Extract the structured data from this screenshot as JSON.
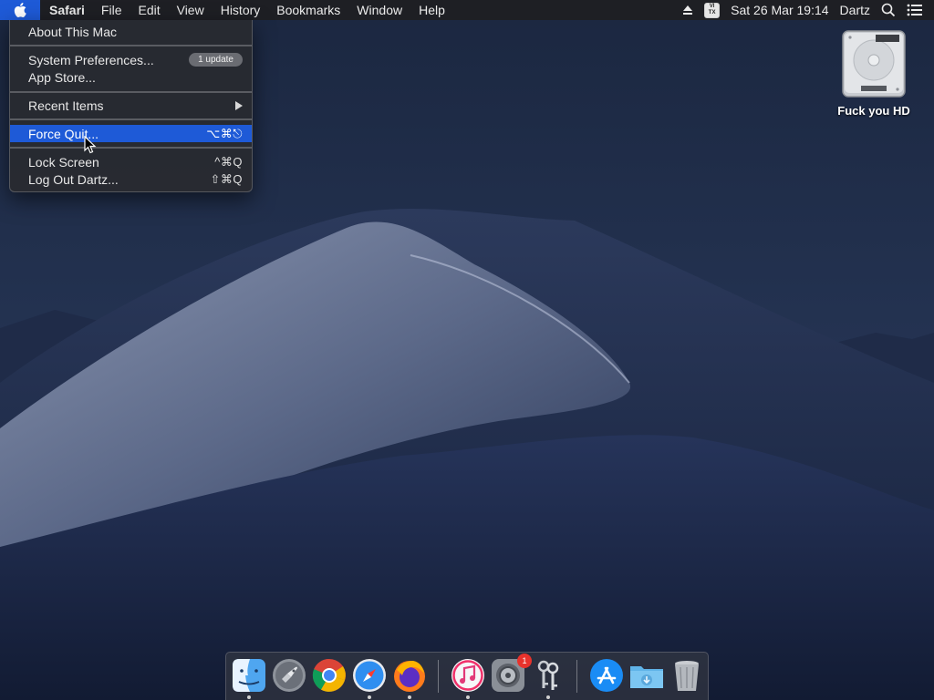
{
  "menubar": {
    "app_name": "Safari",
    "menus": [
      "File",
      "Edit",
      "View",
      "History",
      "Bookmarks",
      "Window",
      "Help"
    ],
    "input_source": [
      "VI",
      "TX"
    ],
    "datetime": "Sat 26 Mar  19:14",
    "user": "Dartz",
    "icons": [
      "apple-icon",
      "eject-icon",
      "input-source-icon",
      "spotlight-search-icon",
      "notification-center-icon"
    ]
  },
  "apple_menu": {
    "about": "About This Mac",
    "system_preferences": "System Preferences...",
    "system_preferences_badge": "1 update",
    "app_store": "App Store...",
    "recent_items": "Recent Items",
    "force_quit": "Force Quit...",
    "force_quit_shortcut": "⌥⌘⎋",
    "lock_screen": "Lock Screen",
    "lock_screen_shortcut": "^⌘Q",
    "log_out": "Log Out Dartz...",
    "log_out_shortcut": "⇧⌘Q",
    "highlighted": "Force Quit..."
  },
  "desktop": {
    "drive_label": "Fuck you HD"
  },
  "dock": {
    "apps": [
      "Finder",
      "Launchpad",
      "Google Chrome",
      "Safari",
      "Firefox",
      "iTunes",
      "System Preferences",
      "Keychain Access",
      "App Store",
      "Downloads",
      "Trash"
    ],
    "system_preferences_badge": "1"
  },
  "colors": {
    "menu_highlight": "#1e5ad7",
    "menubar_bg": "#1e1f24",
    "badge_red": "#e8322c"
  }
}
